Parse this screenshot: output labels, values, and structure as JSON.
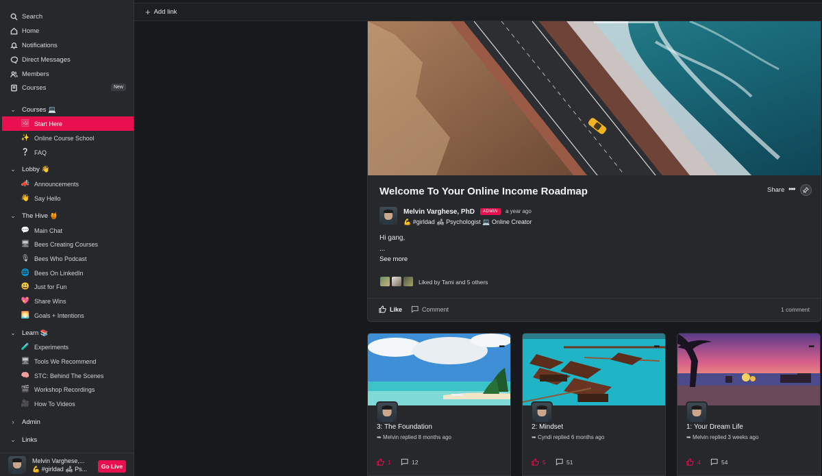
{
  "sidebar": {
    "top_nav": [
      {
        "label": "Search",
        "icon": "search-icon"
      },
      {
        "label": "Home",
        "icon": "home-icon"
      },
      {
        "label": "Notifications",
        "icon": "bell-icon"
      },
      {
        "label": "Direct Messages",
        "icon": "chat-bubble-icon"
      },
      {
        "label": "Members",
        "icon": "users-icon"
      },
      {
        "label": "Courses",
        "icon": "book-icon",
        "badge": "New"
      }
    ],
    "sections": [
      {
        "label": "Courses 💻",
        "expanded": true,
        "items": [
          {
            "emoji": "🖼",
            "label": "Start Here",
            "active": true
          },
          {
            "emoji": "✨",
            "label": "Online Course School"
          },
          {
            "emoji": "❔",
            "label": "FAQ"
          }
        ]
      },
      {
        "label": "Lobby 👋",
        "expanded": true,
        "items": [
          {
            "emoji": "📣",
            "label": "Announcements"
          },
          {
            "emoji": "👋",
            "label": "Say Hello"
          }
        ]
      },
      {
        "label": "The Hive 🍯",
        "expanded": true,
        "items": [
          {
            "emoji": "💬",
            "label": "Main Chat"
          },
          {
            "emoji": "🖥",
            "label": "Bees Creating Courses"
          },
          {
            "emoji": "🎙",
            "label": "Bees Who Podcast"
          },
          {
            "emoji": "🌐",
            "label": "Bees On LinkedIn"
          },
          {
            "emoji": "😃",
            "label": "Just for Fun"
          },
          {
            "emoji": "💖",
            "label": "Share Wins"
          },
          {
            "emoji": "🌅",
            "label": "Goals + Intentions"
          }
        ]
      },
      {
        "label": "Learn 📚",
        "expanded": true,
        "items": [
          {
            "emoji": "🧪",
            "label": "Experiments"
          },
          {
            "emoji": "🖥",
            "label": "Tools We Recommend"
          },
          {
            "emoji": "🧠",
            "label": "STC: Behind The Scenes"
          },
          {
            "emoji": "🎬",
            "label": "Workshop Recordings"
          },
          {
            "emoji": "🎥",
            "label": "How To Videos"
          }
        ]
      },
      {
        "label": "Admin",
        "expanded": false,
        "items": []
      },
      {
        "label": "Links",
        "expanded": true,
        "items": []
      }
    ],
    "footer": {
      "user_name": "Melvin Varghese,...",
      "user_bio": "💪 #girldad 🛋 Ps...",
      "go_live_label": "Go Live"
    }
  },
  "topbar": {
    "add_link_label": "Add link"
  },
  "post": {
    "title": "Welcome To Your Online Income Roadmap",
    "share_label": "Share",
    "more_label": "•••",
    "author": {
      "name": "Melvin Varghese, PhD",
      "badge": "ADMIN",
      "time": "a year ago",
      "bio": "💪 #girldad 🛋 Psychologist 💻 Online Creator"
    },
    "body_line1": "Hi gang,",
    "body_line2": "...",
    "see_more_label": "See more",
    "liked_by": "Liked by Tami and 5 others",
    "like_label": "Like",
    "comment_label": "Comment",
    "comment_count": "1 comment"
  },
  "cards": [
    {
      "title": "3: The Foundation",
      "reply": "Melvin replied 8 months ago",
      "likes": "1",
      "comments": "12",
      "dots": "•••"
    },
    {
      "title": "2: Mindset",
      "reply": "Cyndi replied 6 months ago",
      "likes": "5",
      "comments": "51",
      "dots": "•••"
    },
    {
      "title": "1: Your Dream Life",
      "reply": "Melvin replied 3 weeks ago",
      "likes": "4",
      "comments": "54",
      "dots": "•••"
    }
  ],
  "colors": {
    "accent": "#e8104f",
    "sidebar_bg": "#26282c",
    "page_bg": "#18191c"
  }
}
